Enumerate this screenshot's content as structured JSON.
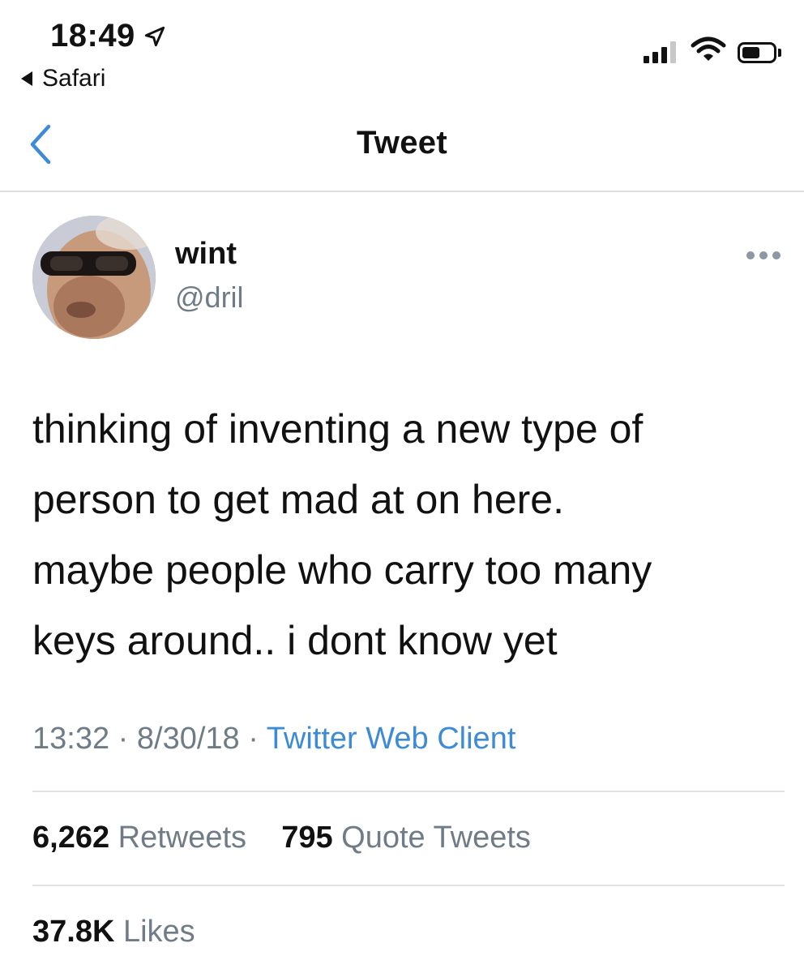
{
  "status_bar": {
    "time": "18:49",
    "back_app": "Safari"
  },
  "header": {
    "title": "Tweet"
  },
  "author": {
    "name": "wint",
    "handle": "@dril"
  },
  "tweet": {
    "text": "thinking of inventing a new type of\nperson to get mad at on here.\nmaybe people who carry too many\nkeys around.. i dont know yet",
    "time": "13:32",
    "date": "8/30/18",
    "client": "Twitter Web Client",
    "separator": "·"
  },
  "stats": {
    "retweets": {
      "count": "6,262",
      "label": "Retweets"
    },
    "quote_tweets": {
      "count": "795",
      "label": "Quote Tweets"
    },
    "likes": {
      "count": "37.8K",
      "label": "Likes"
    }
  },
  "colors": {
    "link": "#3d8bd6",
    "secondary_text": "#6f7c87",
    "divider": "#e3e3e3"
  }
}
